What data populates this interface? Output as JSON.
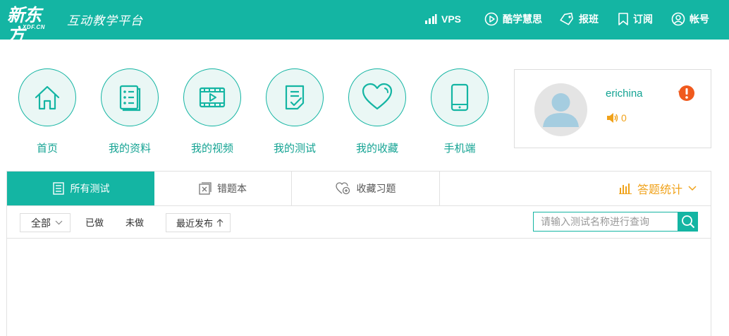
{
  "colors": {
    "brand": "#14b5a3",
    "accent_orange": "#f0a21a",
    "alert_red": "#f05a1e"
  },
  "header": {
    "logo_text": "新东方",
    "logo_sub": "XDF.CN",
    "platform_title": "互动教学平台",
    "nav": [
      {
        "label": "VPS",
        "icon": "signal-bars-icon"
      },
      {
        "label": "酷学慧思",
        "icon": "play-circle-icon"
      },
      {
        "label": "报班",
        "icon": "tag-icon"
      },
      {
        "label": "订阅",
        "icon": "bookmark-icon"
      },
      {
        "label": "帐号",
        "icon": "user-circle-icon"
      }
    ]
  },
  "quick_links": [
    {
      "label": "首页",
      "icon": "home-icon"
    },
    {
      "label": "我的资料",
      "icon": "document-list-icon"
    },
    {
      "label": "我的视频",
      "icon": "video-icon"
    },
    {
      "label": "我的测试",
      "icon": "test-check-icon"
    },
    {
      "label": "我的收藏",
      "icon": "heart-icon"
    },
    {
      "label": "手机端",
      "icon": "mobile-icon"
    }
  ],
  "profile": {
    "username": "erichina",
    "points": "0"
  },
  "tabs": [
    {
      "label": "所有测试",
      "icon": "list-icon",
      "active": true
    },
    {
      "label": "错题本",
      "icon": "wrong-book-icon",
      "active": false
    },
    {
      "label": "收藏习题",
      "icon": "heart-plus-icon",
      "active": false
    }
  ],
  "stats_label": "答题统计",
  "filters": {
    "select_value": "全部",
    "done": "已做",
    "undone": "未做",
    "sort_label": "最近发布",
    "search_placeholder": "请输入测试名称进行查询"
  }
}
